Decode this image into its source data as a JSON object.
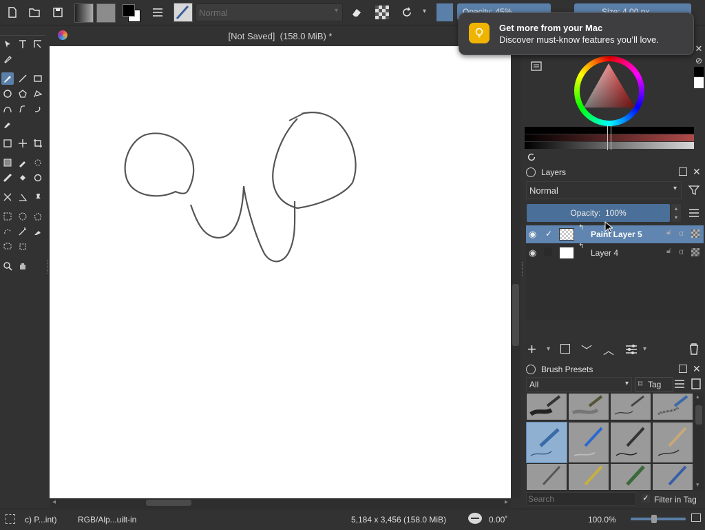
{
  "toolbar": {
    "blend_mode": "Normal",
    "opacity_label": "Opacity: 45%",
    "size_label": "Size: 4.00 px"
  },
  "document": {
    "title": "[Not Saved]  (158.0 MiB) *"
  },
  "notification": {
    "title": "Get more from your Mac",
    "body": "Discover must-know features you’ll love."
  },
  "layers_panel": {
    "title": "Layers",
    "blend_mode": "Normal",
    "opacity_label": "Opacity:  100%",
    "opacity_value": 100,
    "layers": [
      {
        "name": "Paint Layer 5",
        "selected": true
      },
      {
        "name": "Layer 4",
        "selected": false
      }
    ]
  },
  "brush_presets": {
    "title": "Brush Presets",
    "filter": "All",
    "tag_label": "Tag",
    "search_placeholder": "Search",
    "filter_in_tag_label": "Filter in Tag"
  },
  "status_bar": {
    "brush_name": "c) P...int)",
    "color_profile": "RGB/Alp...uilt-in",
    "dimensions": "5,184 x 3,456 (158.0 MiB)",
    "rotation": "0.00˚",
    "zoom": "100.0%"
  },
  "colors": {
    "accent": "#5a7fa8",
    "selected_layer": "#5f85b0",
    "canvas": "#ffffff",
    "panel": "#323232"
  }
}
